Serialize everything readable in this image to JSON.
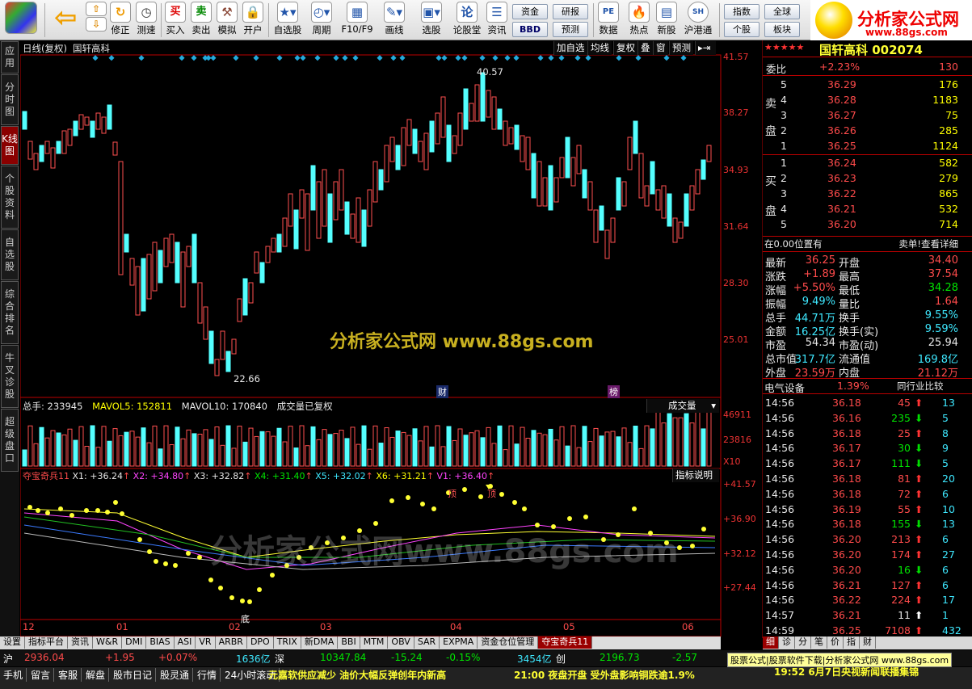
{
  "toolbar": {
    "buttons": [
      "修正",
      "测速",
      "买入",
      "卖出",
      "模拟",
      "开户",
      "自选股",
      "周期",
      "F10/F9",
      "画线",
      "选股",
      "论股堂",
      "资讯",
      "数据",
      "热点",
      "新股",
      "沪港通"
    ],
    "mini": [
      "资金",
      "BBD",
      "研报",
      "预测",
      "指数",
      "个股",
      "全球",
      "板块"
    ]
  },
  "logo": {
    "title": "分析家公式网",
    "url": "www.88gs.com"
  },
  "left_tabs": [
    "应用",
    "分时图",
    "K线图",
    "个股资料",
    "自选股",
    "综合排名",
    "牛叉诊股",
    "超级盘口"
  ],
  "chart": {
    "title": "日线(复权)",
    "name": "国轩高科",
    "controls": [
      "加自选",
      "均线",
      "复权",
      "叠",
      "窗",
      "预测"
    ],
    "price_axis": [
      "41.57",
      "38.27",
      "34.93",
      "31.64",
      "28.30",
      "25.01"
    ],
    "high_label": "40.57",
    "low_label": "22.66",
    "markers": [
      "财",
      "榜"
    ],
    "vol_header": {
      "total": "总手: 233945",
      "ma5": "MAVOL5: 152811",
      "ma10": "MAVOL10: 170840",
      "note": "成交量已复权"
    },
    "vol_select": "成交量",
    "vol_axis": [
      "46911",
      "23816",
      "X10"
    ],
    "ind_header": {
      "name": "夺宝奇兵11",
      "x1": "X1: +36.24",
      "x2": "X2: +34.80",
      "x3": "X3: +32.82",
      "x4": "X4: +31.40",
      "x5": "X5: +32.02",
      "x6": "X6: +31.21",
      "v1": "V1: +36.40"
    },
    "ind_button": "指标说明",
    "ind_axis": [
      "+41.57",
      "+36.90",
      "+32.12",
      "+27.44"
    ],
    "ind_labels": [
      "底",
      "顶",
      "顶"
    ],
    "months": [
      "12",
      "01",
      "02",
      "03",
      "04",
      "05",
      "06"
    ],
    "watermark1": "分析家公式网 www.88gs.com",
    "watermark2": "分析家公式网www.88gs.com"
  },
  "right": {
    "title": "国轩高科 002074",
    "weibi": {
      "label": "委比",
      "value": "+2.23%",
      "diff": "130"
    },
    "sell": [
      [
        "5",
        "36.29",
        "176"
      ],
      [
        "4",
        "36.28",
        "1183"
      ],
      [
        "3",
        "36.27",
        "75"
      ],
      [
        "2",
        "36.26",
        "285"
      ],
      [
        "1",
        "36.25",
        "1124"
      ]
    ],
    "buy": [
      [
        "1",
        "36.24",
        "582"
      ],
      [
        "2",
        "36.23",
        "279"
      ],
      [
        "3",
        "36.22",
        "865"
      ],
      [
        "4",
        "36.21",
        "532"
      ],
      [
        "5",
        "36.20",
        "714"
      ]
    ],
    "sell_label": [
      "卖",
      "盘"
    ],
    "buy_label": [
      "买",
      "盘"
    ],
    "pos": {
      "left": "在0.00位置有",
      "right": "卖单!查看详细"
    },
    "stats": [
      [
        "最新",
        "36.25",
        "开盘",
        "34.40"
      ],
      [
        "涨跌",
        "+1.89",
        "最高",
        "37.54"
      ],
      [
        "涨幅",
        "+5.50%",
        "最低",
        "34.28"
      ],
      [
        "振幅",
        "9.49%",
        "量比",
        "1.64"
      ],
      [
        "总手",
        "44.71万",
        "换手",
        "9.55%"
      ],
      [
        "金额",
        "16.25亿",
        "换手(实)",
        "9.59%"
      ],
      [
        "市盈",
        "54.34",
        "市盈(动)",
        "25.94"
      ],
      [
        "总市值",
        "317.7亿",
        "流通值",
        "169.8亿"
      ],
      [
        "外盘",
        "23.59万",
        "内盘",
        "21.12万"
      ]
    ],
    "sector": {
      "name": "电气设备",
      "pct": "1.39%",
      "btn": "同行业比较"
    },
    "ticks": [
      [
        "14:56",
        "36.18",
        "45",
        "up",
        "13"
      ],
      [
        "14:56",
        "36.16",
        "235",
        "dn",
        "5"
      ],
      [
        "14:56",
        "36.18",
        "25",
        "up",
        "8"
      ],
      [
        "14:56",
        "36.17",
        "30",
        "dn",
        "9"
      ],
      [
        "14:56",
        "36.17",
        "111",
        "dn",
        "5"
      ],
      [
        "14:56",
        "36.18",
        "81",
        "up",
        "20"
      ],
      [
        "14:56",
        "36.18",
        "72",
        "up",
        "6"
      ],
      [
        "14:56",
        "36.19",
        "55",
        "up",
        "10"
      ],
      [
        "14:56",
        "36.18",
        "155",
        "dn",
        "13"
      ],
      [
        "14:56",
        "36.20",
        "213",
        "up",
        "6"
      ],
      [
        "14:56",
        "36.20",
        "174",
        "up",
        "27"
      ],
      [
        "14:56",
        "36.20",
        "16",
        "dn",
        "6"
      ],
      [
        "14:56",
        "36.21",
        "127",
        "up",
        "6"
      ],
      [
        "14:56",
        "36.22",
        "224",
        "up",
        "17"
      ],
      [
        "14:57",
        "36.21",
        "11",
        "wt",
        "1"
      ],
      [
        "14:59",
        "36.25",
        "7108",
        "up",
        "432"
      ]
    ],
    "bottom_tabs": [
      "细",
      "诊",
      "分",
      "笔",
      "价",
      "指",
      "财"
    ]
  },
  "bottom_tabs": [
    "设置",
    "指标平台",
    "资讯",
    "W&R",
    "DMI",
    "BIAS",
    "ASI",
    "VR",
    "ARBR",
    "DPO",
    "TRIX",
    "新DMA",
    "BBI",
    "MTM",
    "OBV",
    "SAR",
    "EXPMA",
    "资金仓位管理",
    "夺宝奇兵11"
  ],
  "status1": {
    "sh": "沪",
    "sh_idx": "2936.04",
    "sh_chg": "+1.95",
    "sh_pct": "+0.07%",
    "sh_amt": "1636亿",
    "sz": "深",
    "sz_idx": "10347.84",
    "sz_chg": "-15.24",
    "sz_pct": "-0.15%",
    "sz_amt": "3454亿",
    "cy": "创",
    "cy_idx": "2196.73",
    "cy_chg": "-2.57",
    "ad": "股票公式|股票软件下载|分析家公式网 www.88gs.com"
  },
  "status2": {
    "items": [
      "手机",
      "留言",
      "客服",
      "解盘",
      "股市日记",
      "股灵通",
      "行情",
      "24小时滚动"
    ],
    "news1": "元嘉软供应减少 油价大幅反弹创年内新高",
    "news2": "21:00 夜盘开盘 受外盘影响铜跌逾1.9%",
    "news3": "19:52 6月7日央视新闻联播集锦"
  }
}
